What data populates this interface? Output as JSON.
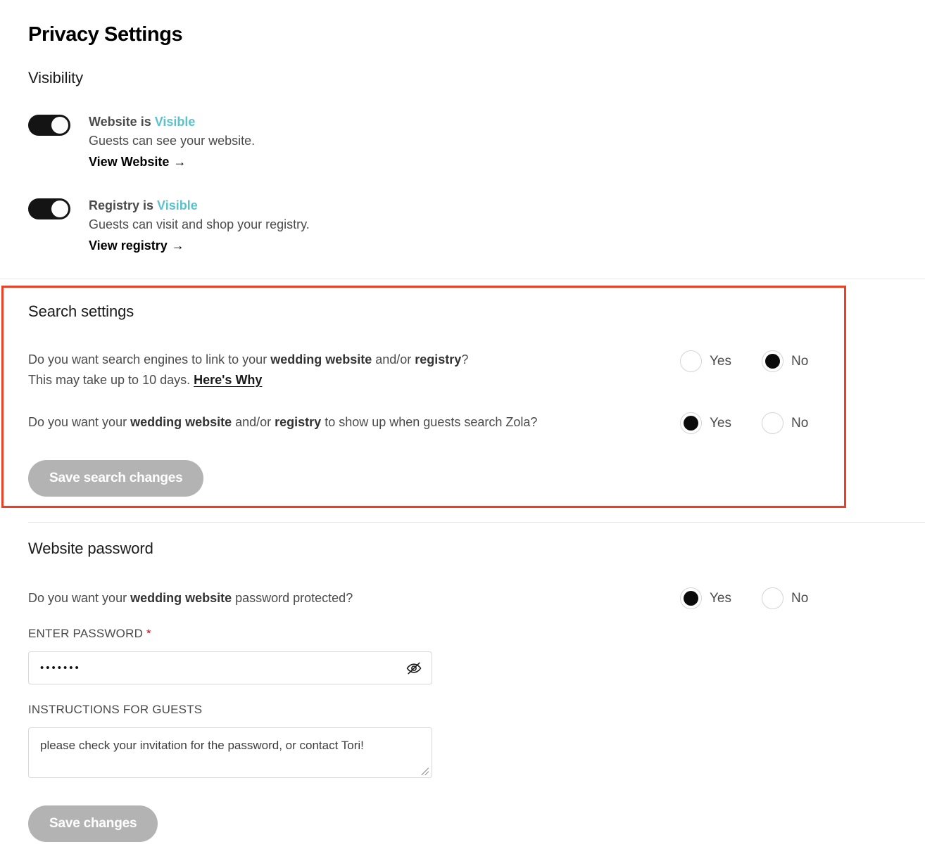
{
  "page": {
    "title": "Privacy Settings"
  },
  "visibility": {
    "heading": "Visibility",
    "toggles": [
      {
        "name": "website",
        "title_prefix": "Website is ",
        "state": "Visible",
        "state_color": "#5bc2cc",
        "description": "Guests can see your website.",
        "link": "View Website",
        "link_arrow": "→",
        "toggle_on": true
      },
      {
        "name": "registry",
        "title_prefix": "Registry is ",
        "state": "Visible",
        "state_color": "#5bc2cc",
        "description": "Guests can visit and shop your registry.",
        "link": "View registry",
        "link_arrow": "→",
        "toggle_on": true
      }
    ]
  },
  "search_settings": {
    "heading": "Search settings",
    "highlighted": true,
    "highlight_color": "#ea4026",
    "questions": [
      {
        "name": "search-engines",
        "line1_a": "Do you want search engines to link to your ",
        "line1_b": "wedding website",
        "line1_c": " and/or ",
        "line1_d": "registry",
        "line1_e": "?",
        "line2_a": "This may take up to 10 days. ",
        "line2_link": "Here's Why",
        "options": [
          "Yes",
          "No"
        ],
        "selected": "No"
      },
      {
        "name": "zola-search",
        "line1_a": "Do you want your ",
        "line1_b": "wedding website",
        "line1_c": " and/or ",
        "line1_d": "registry",
        "line1_e": " to show up when guests search Zola?",
        "options": [
          "Yes",
          "No"
        ],
        "selected": "Yes"
      }
    ],
    "save_button": "Save search changes",
    "save_button_enabled": false
  },
  "website_password": {
    "heading": "Website password",
    "question": {
      "a": "Do you want your ",
      "b": "wedding website",
      "c": " password protected?",
      "options": [
        "Yes",
        "No"
      ],
      "selected": "Yes"
    },
    "password_field": {
      "label": "ENTER PASSWORD",
      "required_marker": "*",
      "masked_value": "•••••••",
      "reveal_icon": "eye-slash-icon"
    },
    "instructions_field": {
      "label": "INSTRUCTIONS FOR GUESTS",
      "value": "please check your invitation for the password, or contact Tori!"
    },
    "save_button": "Save changes",
    "save_button_enabled": false
  }
}
